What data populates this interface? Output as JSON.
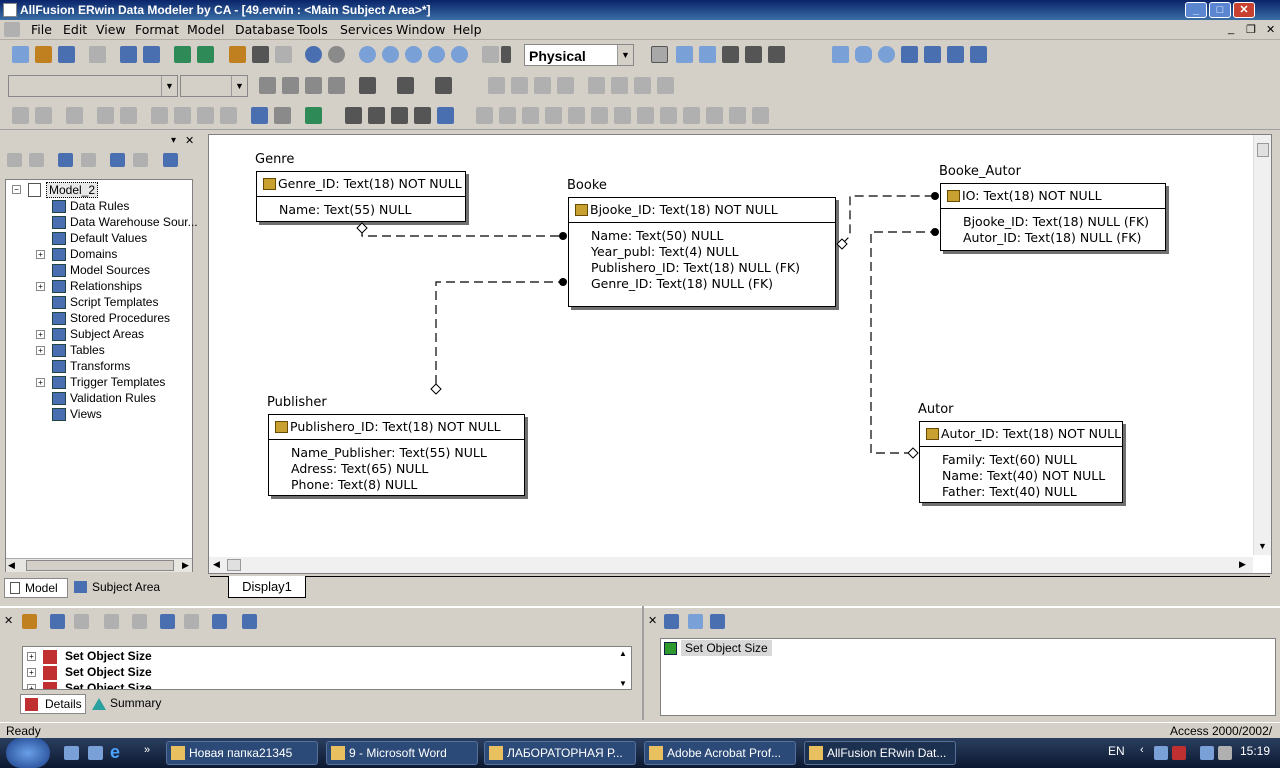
{
  "window": {
    "title": "AllFusion ERwin Data Modeler by CA - [49.erwin : <Main Subject Area>*]"
  },
  "menu": [
    "File",
    "Edit",
    "View",
    "Format",
    "Model",
    "Database",
    "Tools",
    "Services",
    "Window",
    "Help"
  ],
  "toolbar": {
    "view_mode": "Physical"
  },
  "tree": {
    "root": "Model_2",
    "items": [
      "Data Rules",
      "Data Warehouse Sour...",
      "Default Values",
      "Domains",
      "Model Sources",
      "Relationships",
      "Script Templates",
      "Stored Procedures",
      "Subject Areas",
      "Tables",
      "Transforms",
      "Trigger Templates",
      "Validation Rules",
      "Views"
    ],
    "expandable": [
      false,
      false,
      false,
      true,
      false,
      true,
      false,
      false,
      true,
      true,
      false,
      true,
      false,
      false
    ]
  },
  "left_tabs": {
    "model": "Model",
    "subject_area": "Subject Area"
  },
  "entities": {
    "genre": {
      "name": "Genre",
      "pk": "Genre_ID: Text(18) NOT NULL",
      "attrs": [
        "Name: Text(55) NULL"
      ]
    },
    "booke": {
      "name": "Booke",
      "pk": "Bjooke_ID: Text(18) NOT NULL",
      "attrs": [
        "Name: Text(50) NULL",
        "Year_publ: Text(4) NULL",
        "Publishero_ID: Text(18) NULL (FK)",
        "Genre_ID: Text(18) NULL (FK)"
      ]
    },
    "booke_autor": {
      "name": "Booke_Autor",
      "pk": "IO: Text(18) NOT NULL",
      "attrs": [
        "Bjooke_ID: Text(18) NULL (FK)",
        "Autor_ID: Text(18) NULL (FK)"
      ]
    },
    "publisher": {
      "name": "Publisher",
      "pk": "Publishero_ID: Text(18) NOT NULL",
      "attrs": [
        "Name_Publisher: Text(55) NULL",
        "Adress: Text(65) NULL",
        "Phone: Text(8) NULL"
      ]
    },
    "autor": {
      "name": "Autor",
      "pk": "Autor_ID: Text(18) NOT NULL",
      "attrs": [
        "Family: Text(60) NULL",
        "Name: Text(40) NOT NULL",
        "Father: Text(40) NULL"
      ]
    }
  },
  "diagram_tab": "Display1",
  "details": {
    "rows": [
      "Set Object Size",
      "Set Object Size",
      "Set Object Size"
    ],
    "tab_details": "Details",
    "tab_summary": "Summary"
  },
  "right_panel": {
    "item": "Set Object Size"
  },
  "status": {
    "left": "Ready",
    "right": "Access 2000/2002/"
  },
  "taskbar": {
    "tasks": [
      "Новая папка21345",
      "9 - Microsoft Word",
      "ЛАБОРАТОРНАЯ Р...",
      "Adobe Acrobat Prof...",
      "AllFusion ERwin Dat..."
    ],
    "lang": "EN",
    "clock": "15:19"
  }
}
